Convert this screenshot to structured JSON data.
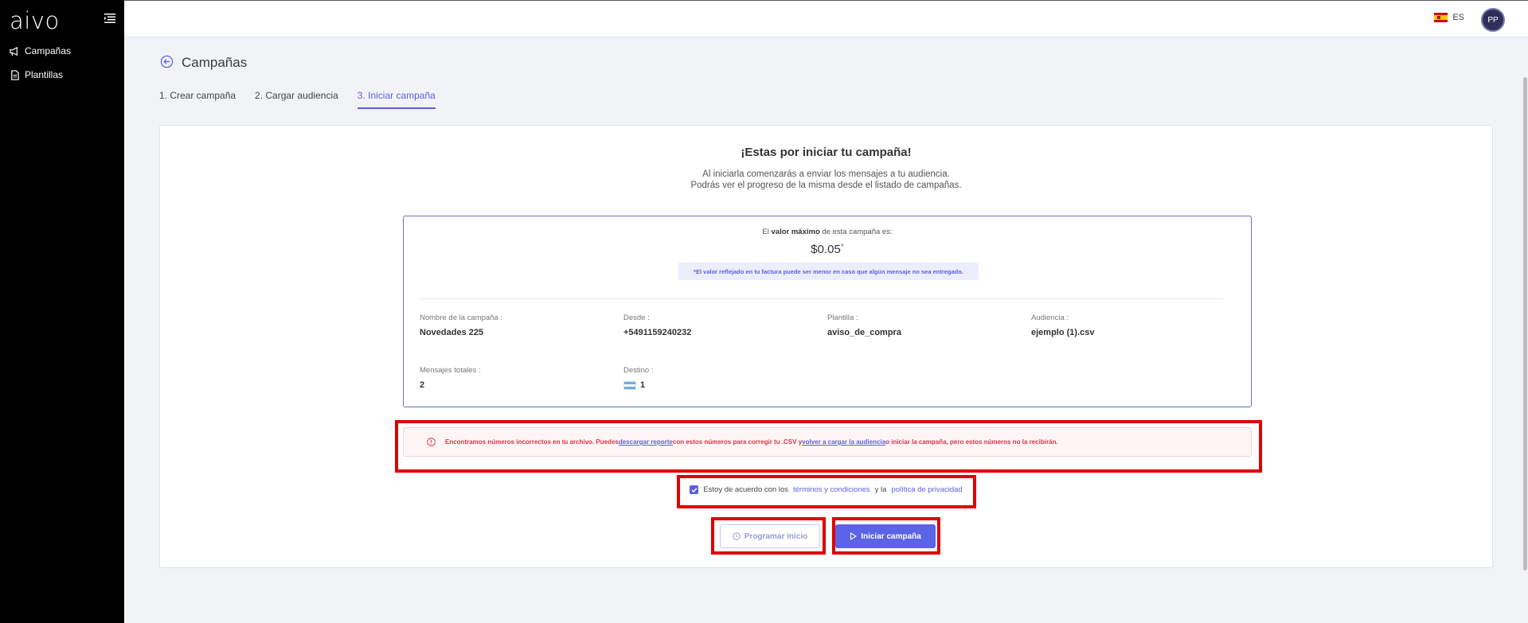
{
  "app": {
    "logo": "aivo"
  },
  "sidebar": {
    "items": [
      {
        "label": "Campañas",
        "icon": "megaphone-icon"
      },
      {
        "label": "Plantillas",
        "icon": "document-icon"
      }
    ]
  },
  "topbar": {
    "language": "ES",
    "avatar_initials": "PP"
  },
  "page": {
    "title": "Campañas",
    "tabs": [
      {
        "label": "1. Crear campaña",
        "active": false
      },
      {
        "label": "2. Cargar audiencia",
        "active": false
      },
      {
        "label": "3. Iniciar campaña",
        "active": true
      }
    ]
  },
  "card": {
    "heading": "¡Estas por iniciar tu campaña!",
    "sub1": "Al iniciarla comenzarás a enviar los mensajes a tu audiencia.",
    "sub2": "Podrás ver el progreso de la misma desde el listado de campañas.",
    "max_label_pre": "El ",
    "max_label_bold": "valor máximo",
    "max_label_post": " de esta campaña es:",
    "max_value": "$0.05",
    "max_asterisk": "*",
    "invoice_note": "*El valor reflejado en tu factura puede ser menor en caso que algún mensaje no sea entregado.",
    "fields": {
      "name_label": "Nombre de la campaña :",
      "name_value": "Novedades 225",
      "from_label": "Desde :",
      "from_value": "+5491159240232",
      "template_label": "Plantilla :",
      "template_value": "aviso_de_compra",
      "audience_label": "Audiencia :",
      "audience_value": "ejemplo (1).csv",
      "total_label": "Mensajes totales :",
      "total_value": "2",
      "dest_label": "Destino :",
      "dest_value": "1"
    },
    "warning": {
      "text1": "Encontramos números incorrectos en tu archivo. Puedes ",
      "link1": "descargar reporte",
      "text2": " con estos números para corregir tu .CSV y ",
      "link2": "volver a cargar la audiencia",
      "text3": " o iniciar la campaña, pero estos números no la recibirán."
    },
    "agreement": {
      "text1": "Estoy de acuerdo con los",
      "link1": "términos y condiciones",
      "text2": "y la",
      "link2": "política de privacidad",
      "checked": true
    },
    "buttons": {
      "schedule": "Programar inicio",
      "start": "Iniciar campaña"
    }
  },
  "colors": {
    "accent": "#5b5fe0",
    "error": "#d4364a",
    "highlight": "#e00000",
    "sidebar": "#000000"
  }
}
